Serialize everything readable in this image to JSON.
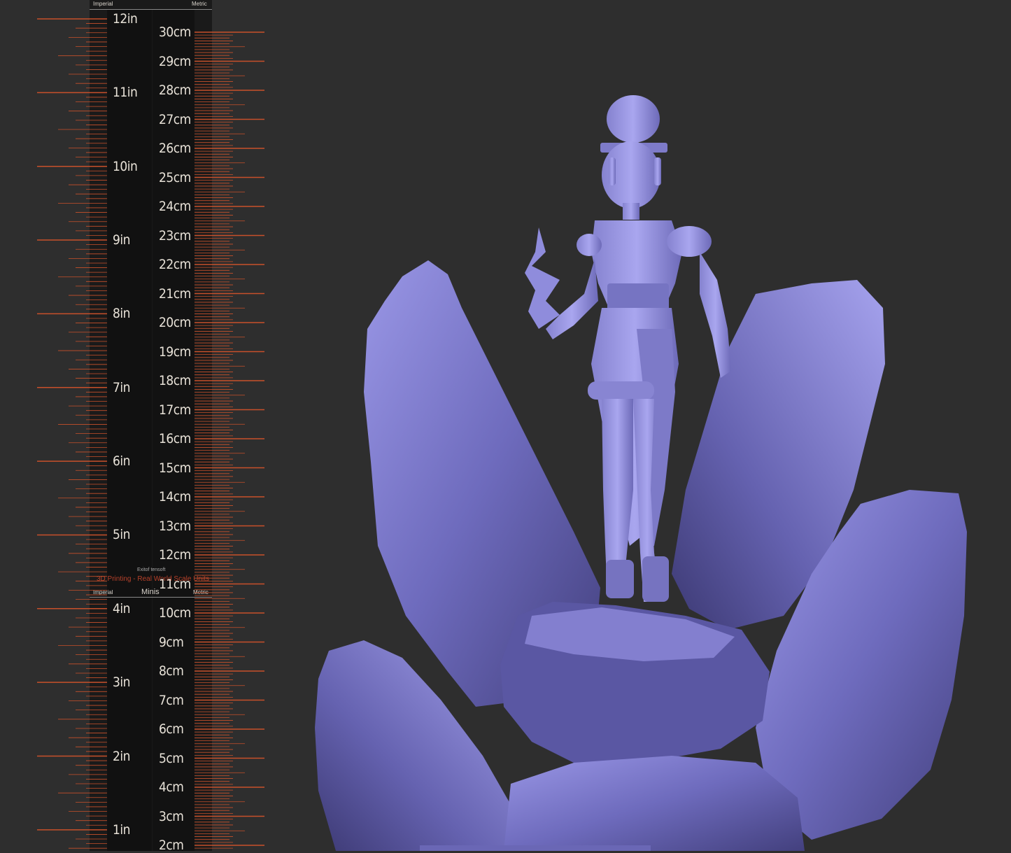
{
  "ruler": {
    "imperial_header": "Imperial",
    "metric_header": "Metric",
    "minis_imperial": "Imperial",
    "minis_label": "Minis",
    "minis_metric": "Metric",
    "watermark_top": "Exitof tensoft",
    "watermark": "3D Printing - Real World Scale Units",
    "inch_labels": [
      "12in",
      "11in",
      "10in",
      "9in",
      "8in",
      "7in",
      "6in",
      "5in",
      "4in",
      "3in",
      "2in",
      "1in"
    ],
    "cm_labels": [
      "30cm",
      "29cm",
      "28cm",
      "27cm",
      "26cm",
      "25cm",
      "24cm",
      "23cm",
      "22cm",
      "21cm",
      "20cm",
      "19cm",
      "18cm",
      "17cm",
      "16cm",
      "15cm",
      "14cm",
      "13cm",
      "12cm",
      "11cm",
      "10cm",
      "9cm",
      "8cm",
      "7cm",
      "6cm",
      "5cm",
      "4cm",
      "3cm",
      "2cm"
    ]
  },
  "colors": {
    "background": "#2e2e2e",
    "ruler_dark": "#141414",
    "tick": "#c8502a",
    "label": "#e8e2d8",
    "model": "#8a87d6"
  },
  "model": {
    "icon": "sculpted-figure-on-rocks"
  }
}
